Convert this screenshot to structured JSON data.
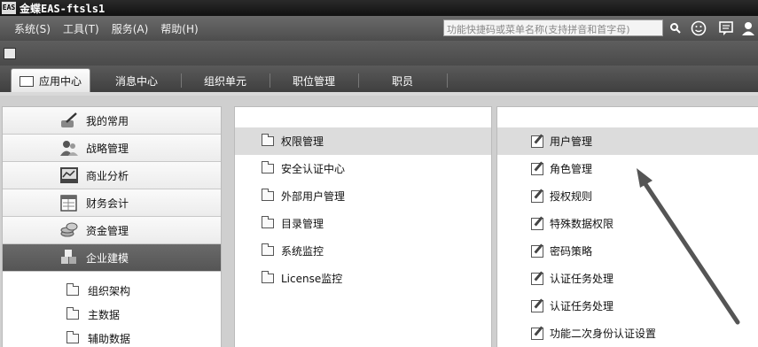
{
  "window": {
    "logo_text": "EAS",
    "title": "金蝶EAS-ftsls1"
  },
  "menubar": {
    "items": [
      "系统(S)",
      "工具(T)",
      "服务(A)",
      "帮助(H)"
    ],
    "search_placeholder": "功能快捷码或菜单名称(支持拼音和首字母)"
  },
  "tabs": [
    "应用中心",
    "消息中心",
    "组织单元",
    "职位管理",
    "职员"
  ],
  "left_nav": {
    "items": [
      {
        "label": "我的常用",
        "icon": "pen-hand-icon"
      },
      {
        "label": "战略管理",
        "icon": "people-icon"
      },
      {
        "label": "商业分析",
        "icon": "chart-icon"
      },
      {
        "label": "财务会计",
        "icon": "calendar-icon"
      },
      {
        "label": "资金管理",
        "icon": "coins-icon"
      },
      {
        "label": "企业建模",
        "icon": "cubes-icon"
      }
    ],
    "active_index": 5,
    "sub_items": [
      "组织架构",
      "主数据",
      "辅助数据"
    ]
  },
  "middle_list": {
    "items": [
      "权限管理",
      "安全认证中心",
      "外部用户管理",
      "目录管理",
      "系统监控",
      "License监控"
    ],
    "active_index": 0
  },
  "right_list": {
    "items": [
      "用户管理",
      "角色管理",
      "授权规则",
      "特殊数据权限",
      "密码策略",
      "认证任务处理",
      "认证任务处理",
      "功能二次身份认证设置"
    ],
    "active_index": 0
  },
  "colors": {
    "menubar": "#5a5a5a",
    "active_nav": "#5f5f5f",
    "selected_row": "#dcdcdc",
    "arrow": "#555555"
  }
}
